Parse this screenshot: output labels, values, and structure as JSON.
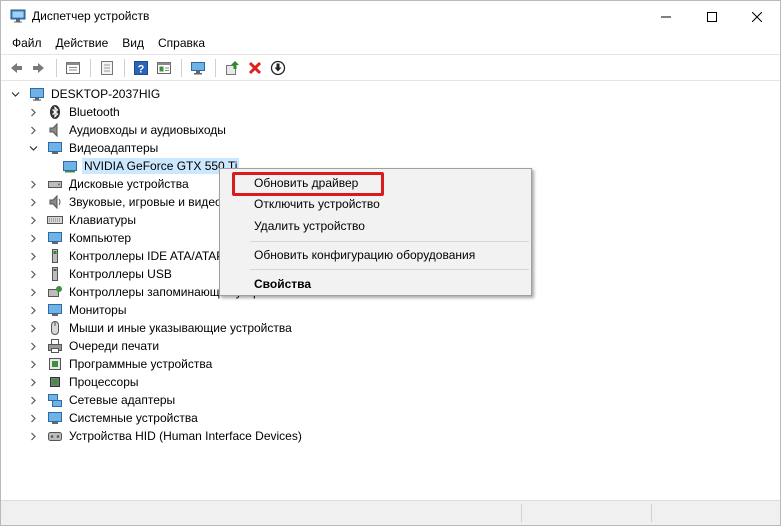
{
  "window": {
    "title": "Диспетчер устройств"
  },
  "menu": [
    "Файл",
    "Действие",
    "Вид",
    "Справка"
  ],
  "toolbar": {
    "icons": [
      "back-arrow-icon",
      "forward-arrow-icon",
      "properties-list-icon",
      "show-hidden-icon",
      "help-icon",
      "view-pane-icon",
      "monitor-scan-icon",
      "update-driver-icon",
      "uninstall-x-icon",
      "download-icon"
    ],
    "accent_red": "#e0201c",
    "accent_green": "#2c8a2c"
  },
  "tree": {
    "root": "DESKTOP-2037HIG",
    "items": [
      {
        "label": "Bluetooth",
        "icon": "bluetooth-icon",
        "expanded": false
      },
      {
        "label": "Аудиовходы и аудиовыходы",
        "icon": "speaker-icon",
        "expanded": false
      },
      {
        "label": "Видеоадаптеры",
        "icon": "display-adapter-icon",
        "expanded": true
      },
      {
        "label": "NVIDIA GeForce GTX 550 Ti",
        "icon": "gpu-icon",
        "child": true,
        "selected": true
      },
      {
        "label": "Дисковые устройства",
        "icon": "disk-icon",
        "expanded": false
      },
      {
        "label": "Звуковые, игровые и видеоустройства",
        "icon": "sound-icon",
        "expanded": false
      },
      {
        "label": "Клавиатуры",
        "icon": "keyboard-icon",
        "expanded": false
      },
      {
        "label": "Компьютер",
        "icon": "computer-icon",
        "expanded": false
      },
      {
        "label": "Контроллеры IDE ATA/ATAPI",
        "icon": "ide-controller-icon",
        "expanded": false
      },
      {
        "label": "Контроллеры USB",
        "icon": "usb-icon",
        "expanded": false
      },
      {
        "label": "Контроллеры запоминающих устройств",
        "icon": "storage-controller-icon",
        "expanded": false
      },
      {
        "label": "Мониторы",
        "icon": "monitor-icon",
        "expanded": false
      },
      {
        "label": "Мыши и иные указывающие устройства",
        "icon": "mouse-icon",
        "expanded": false
      },
      {
        "label": "Очереди печати",
        "icon": "printer-icon",
        "expanded": false
      },
      {
        "label": "Программные устройства",
        "icon": "software-device-icon",
        "expanded": false
      },
      {
        "label": "Процессоры",
        "icon": "processor-icon",
        "expanded": false
      },
      {
        "label": "Сетевые адаптеры",
        "icon": "network-adapter-icon",
        "expanded": false
      },
      {
        "label": "Системные устройства",
        "icon": "system-device-icon",
        "expanded": false
      },
      {
        "label": "Устройства HID (Human Interface Devices)",
        "icon": "hid-icon",
        "expanded": false
      }
    ]
  },
  "context_menu": {
    "items": [
      "Обновить драйвер",
      "Отключить устройство",
      "Удалить устройство",
      "Обновить конфигурацию оборудования",
      "Свойства"
    ],
    "highlight_color": "#d81c1c"
  }
}
